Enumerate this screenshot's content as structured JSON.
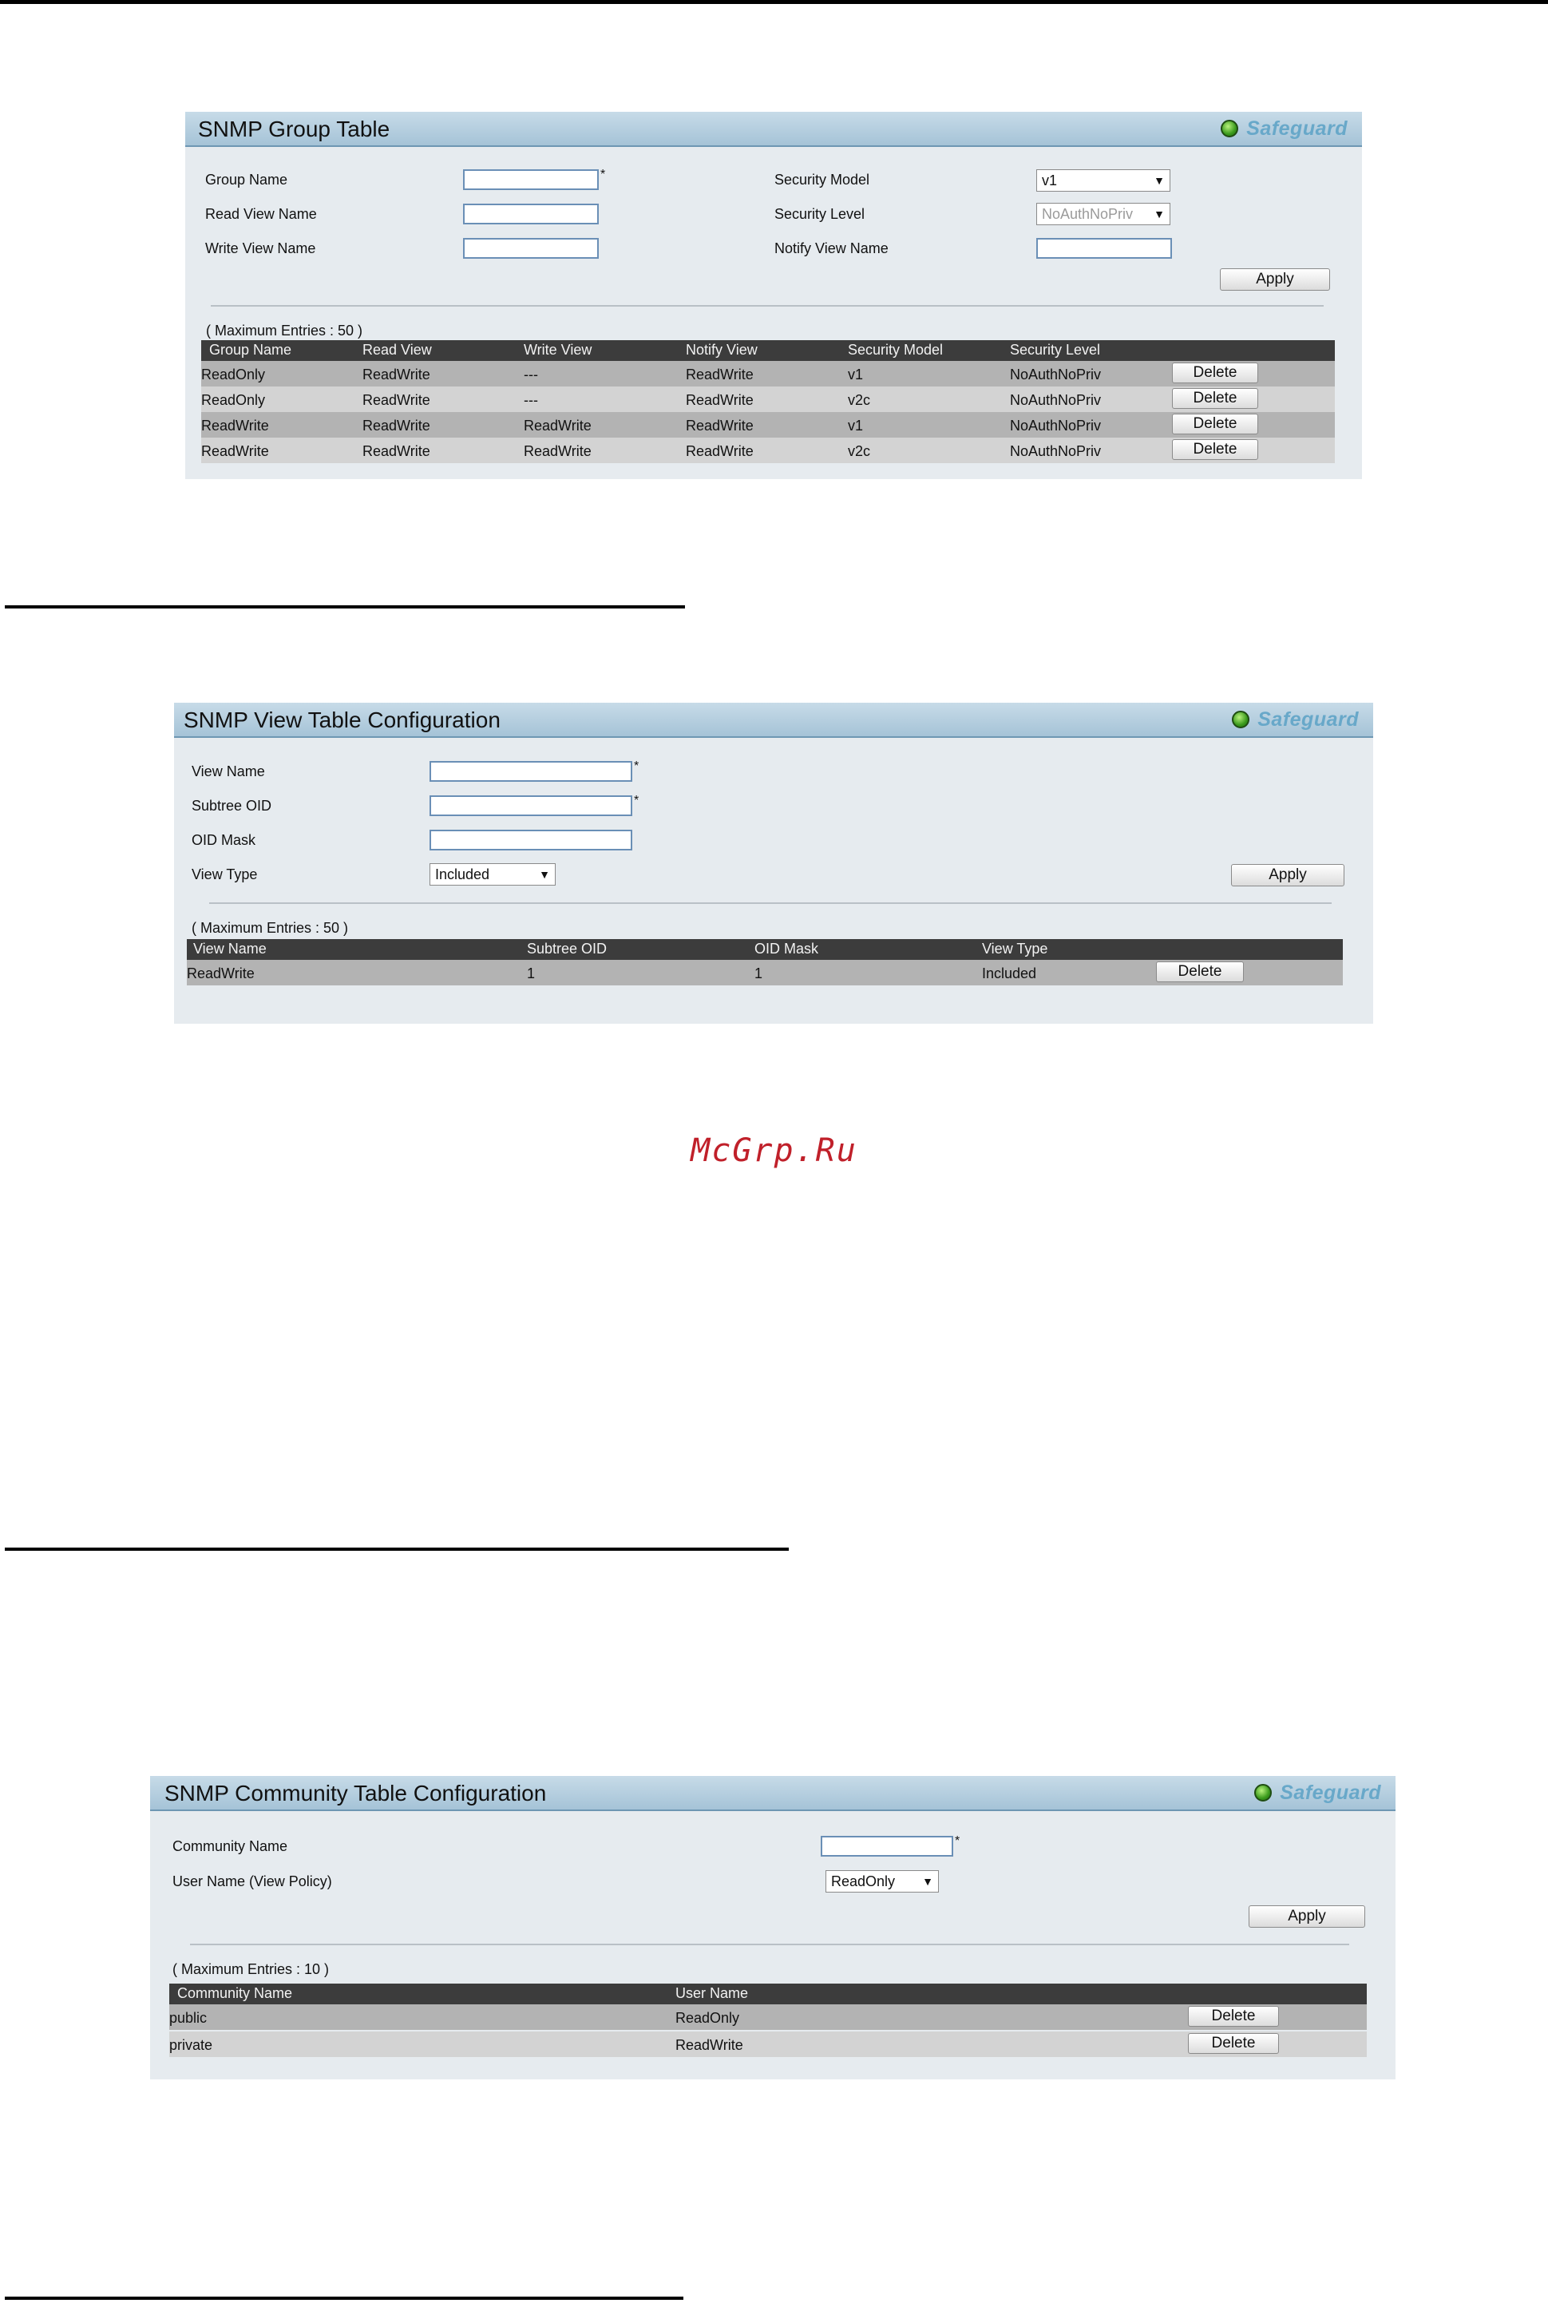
{
  "watermark": "McGrp.Ru",
  "safeguard_label": "Safeguard",
  "group_table": {
    "title": "SNMP Group Table",
    "fields": {
      "group_name_label": "Group Name",
      "read_view_name_label": "Read View Name",
      "write_view_name_label": "Write View Name",
      "security_model_label": "Security Model",
      "security_model_value": "v1",
      "security_level_label": "Security Level",
      "security_level_value": "NoAuthNoPriv",
      "notify_view_name_label": "Notify View Name",
      "required_mark": "*"
    },
    "apply_label": "Apply",
    "max_entries": "( Maximum Entries : 50 )",
    "columns": [
      "Group Name",
      "Read View",
      "Write View",
      "Notify View",
      "Security Model",
      "Security Level"
    ],
    "delete_label": "Delete",
    "rows": [
      [
        "ReadOnly",
        "ReadWrite",
        "---",
        "ReadWrite",
        "v1",
        "NoAuthNoPriv"
      ],
      [
        "ReadOnly",
        "ReadWrite",
        "---",
        "ReadWrite",
        "v2c",
        "NoAuthNoPriv"
      ],
      [
        "ReadWrite",
        "ReadWrite",
        "ReadWrite",
        "ReadWrite",
        "v1",
        "NoAuthNoPriv"
      ],
      [
        "ReadWrite",
        "ReadWrite",
        "ReadWrite",
        "ReadWrite",
        "v2c",
        "NoAuthNoPriv"
      ]
    ]
  },
  "view_table": {
    "title": "SNMP View Table Configuration",
    "fields": {
      "view_name_label": "View Name",
      "subtree_oid_label": "Subtree OID",
      "oid_mask_label": "OID Mask",
      "view_type_label": "View Type",
      "view_type_value": "Included",
      "required_mark": "*"
    },
    "apply_label": "Apply",
    "max_entries": "( Maximum Entries : 50 )",
    "columns": [
      "View Name",
      "Subtree OID",
      "OID Mask",
      "View Type"
    ],
    "delete_label": "Delete",
    "rows": [
      [
        "ReadWrite",
        "1",
        "1",
        "Included"
      ]
    ]
  },
  "community_table": {
    "title": "SNMP Community Table Configuration",
    "fields": {
      "community_name_label": "Community Name",
      "user_name_label": "User Name (View Policy)",
      "user_name_value": "ReadOnly",
      "required_mark": "*"
    },
    "apply_label": "Apply",
    "max_entries": "( Maximum Entries : 10 )",
    "columns": [
      "Community Name",
      "User Name"
    ],
    "delete_label": "Delete",
    "rows": [
      [
        "public",
        "ReadOnly"
      ],
      [
        "private",
        "ReadWrite"
      ]
    ]
  }
}
